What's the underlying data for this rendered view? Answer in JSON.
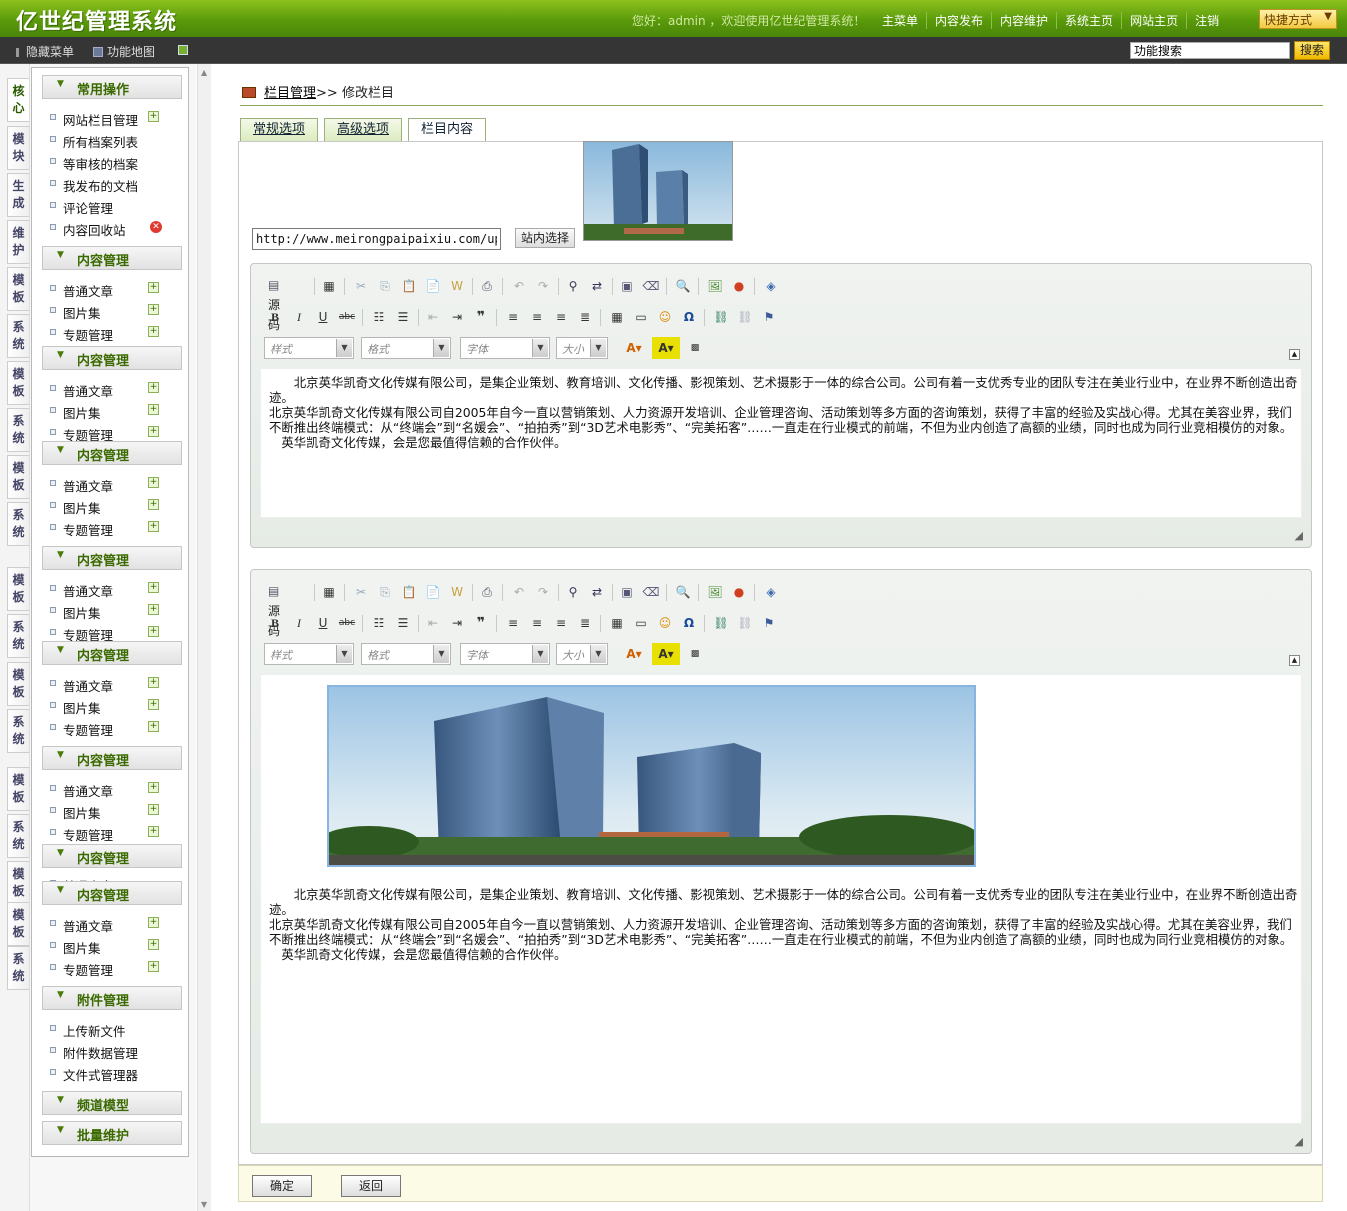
{
  "app": {
    "title": "亿世纪管理系统",
    "welcome": "您好：admin ，欢迎使用亿世纪管理系统！"
  },
  "topnav": [
    "主菜单",
    "内容发布",
    "内容维护",
    "系统主页",
    "网站主页",
    "注销"
  ],
  "quick": {
    "label": "快捷方式",
    "icon": "chevron-down-icon"
  },
  "subbar": {
    "hide_menu": "隐藏菜单",
    "func_map": "功能地图"
  },
  "search": {
    "value": "功能搜索",
    "button": "搜索"
  },
  "side_tabs": [
    "核心",
    "模块",
    "生成",
    "维护",
    "模板",
    "系统",
    "模板",
    "系统",
    "模板",
    "系统",
    "模板",
    "系统",
    "模板",
    "系统",
    "模板",
    "系统",
    "模板",
    "系统",
    "模板",
    "系统"
  ],
  "menu": {
    "common": "常用操作",
    "common_items": [
      "网站栏目管理",
      "所有档案列表",
      "等审核的档案",
      "我发布的文档",
      "评论管理",
      "内容回收站"
    ],
    "content_title": "内容管理",
    "content_items": [
      "普通文章",
      "图片集",
      "专题管理"
    ],
    "clipped_item": "普通文章",
    "attach_title": "附件管理",
    "attach_items": [
      "上传新文件",
      "附件数据管理",
      "文件式管理器"
    ],
    "channel_title": "频道模型",
    "batch_title": "批量维护"
  },
  "crumb": {
    "link": "栏目管理",
    "sep": ">>",
    "current": "修改栏目"
  },
  "tabs": [
    "常规选项",
    "高级选项",
    "栏目内容"
  ],
  "url_value": "http://www.meirongpaipaixiu.com/uploads/",
  "pick_button": "站内选择",
  "toolbar": {
    "source": "源码",
    "style": "样式",
    "format": "格式",
    "font": "字体",
    "size": "大小"
  },
  "article": {
    "p1": "北京英华凯奇文化传媒有限公司，是集企业策划、教育培训、文化传播、影视策划、艺术摄影于一体的综合公司。公司有着一支优秀专业的团队专注在美业行业中，在业界不断创造出奇迹。",
    "p2": "北京英华凯奇文化传媒有限公司自2005年自今一直以营销策划、人力资源开发培训、企业管理咨询、活动策划等多方面的咨询策划，获得了丰富的经验及实战心得。尤其在美容业界，我们不断推出终端模式：从“终端会”到“名媛会”、“拍拍秀”到“3D艺术电影秀”、“完美拓客”……一直走在行业模式的前端，不但为业内创造了高额的业绩，同时也成为同行业竞相模仿的对象。",
    "p3": "英华凯奇文化传媒，会是您最值得信赖的合作伙伴。"
  },
  "buttons": {
    "ok": "确定",
    "back": "返回"
  }
}
